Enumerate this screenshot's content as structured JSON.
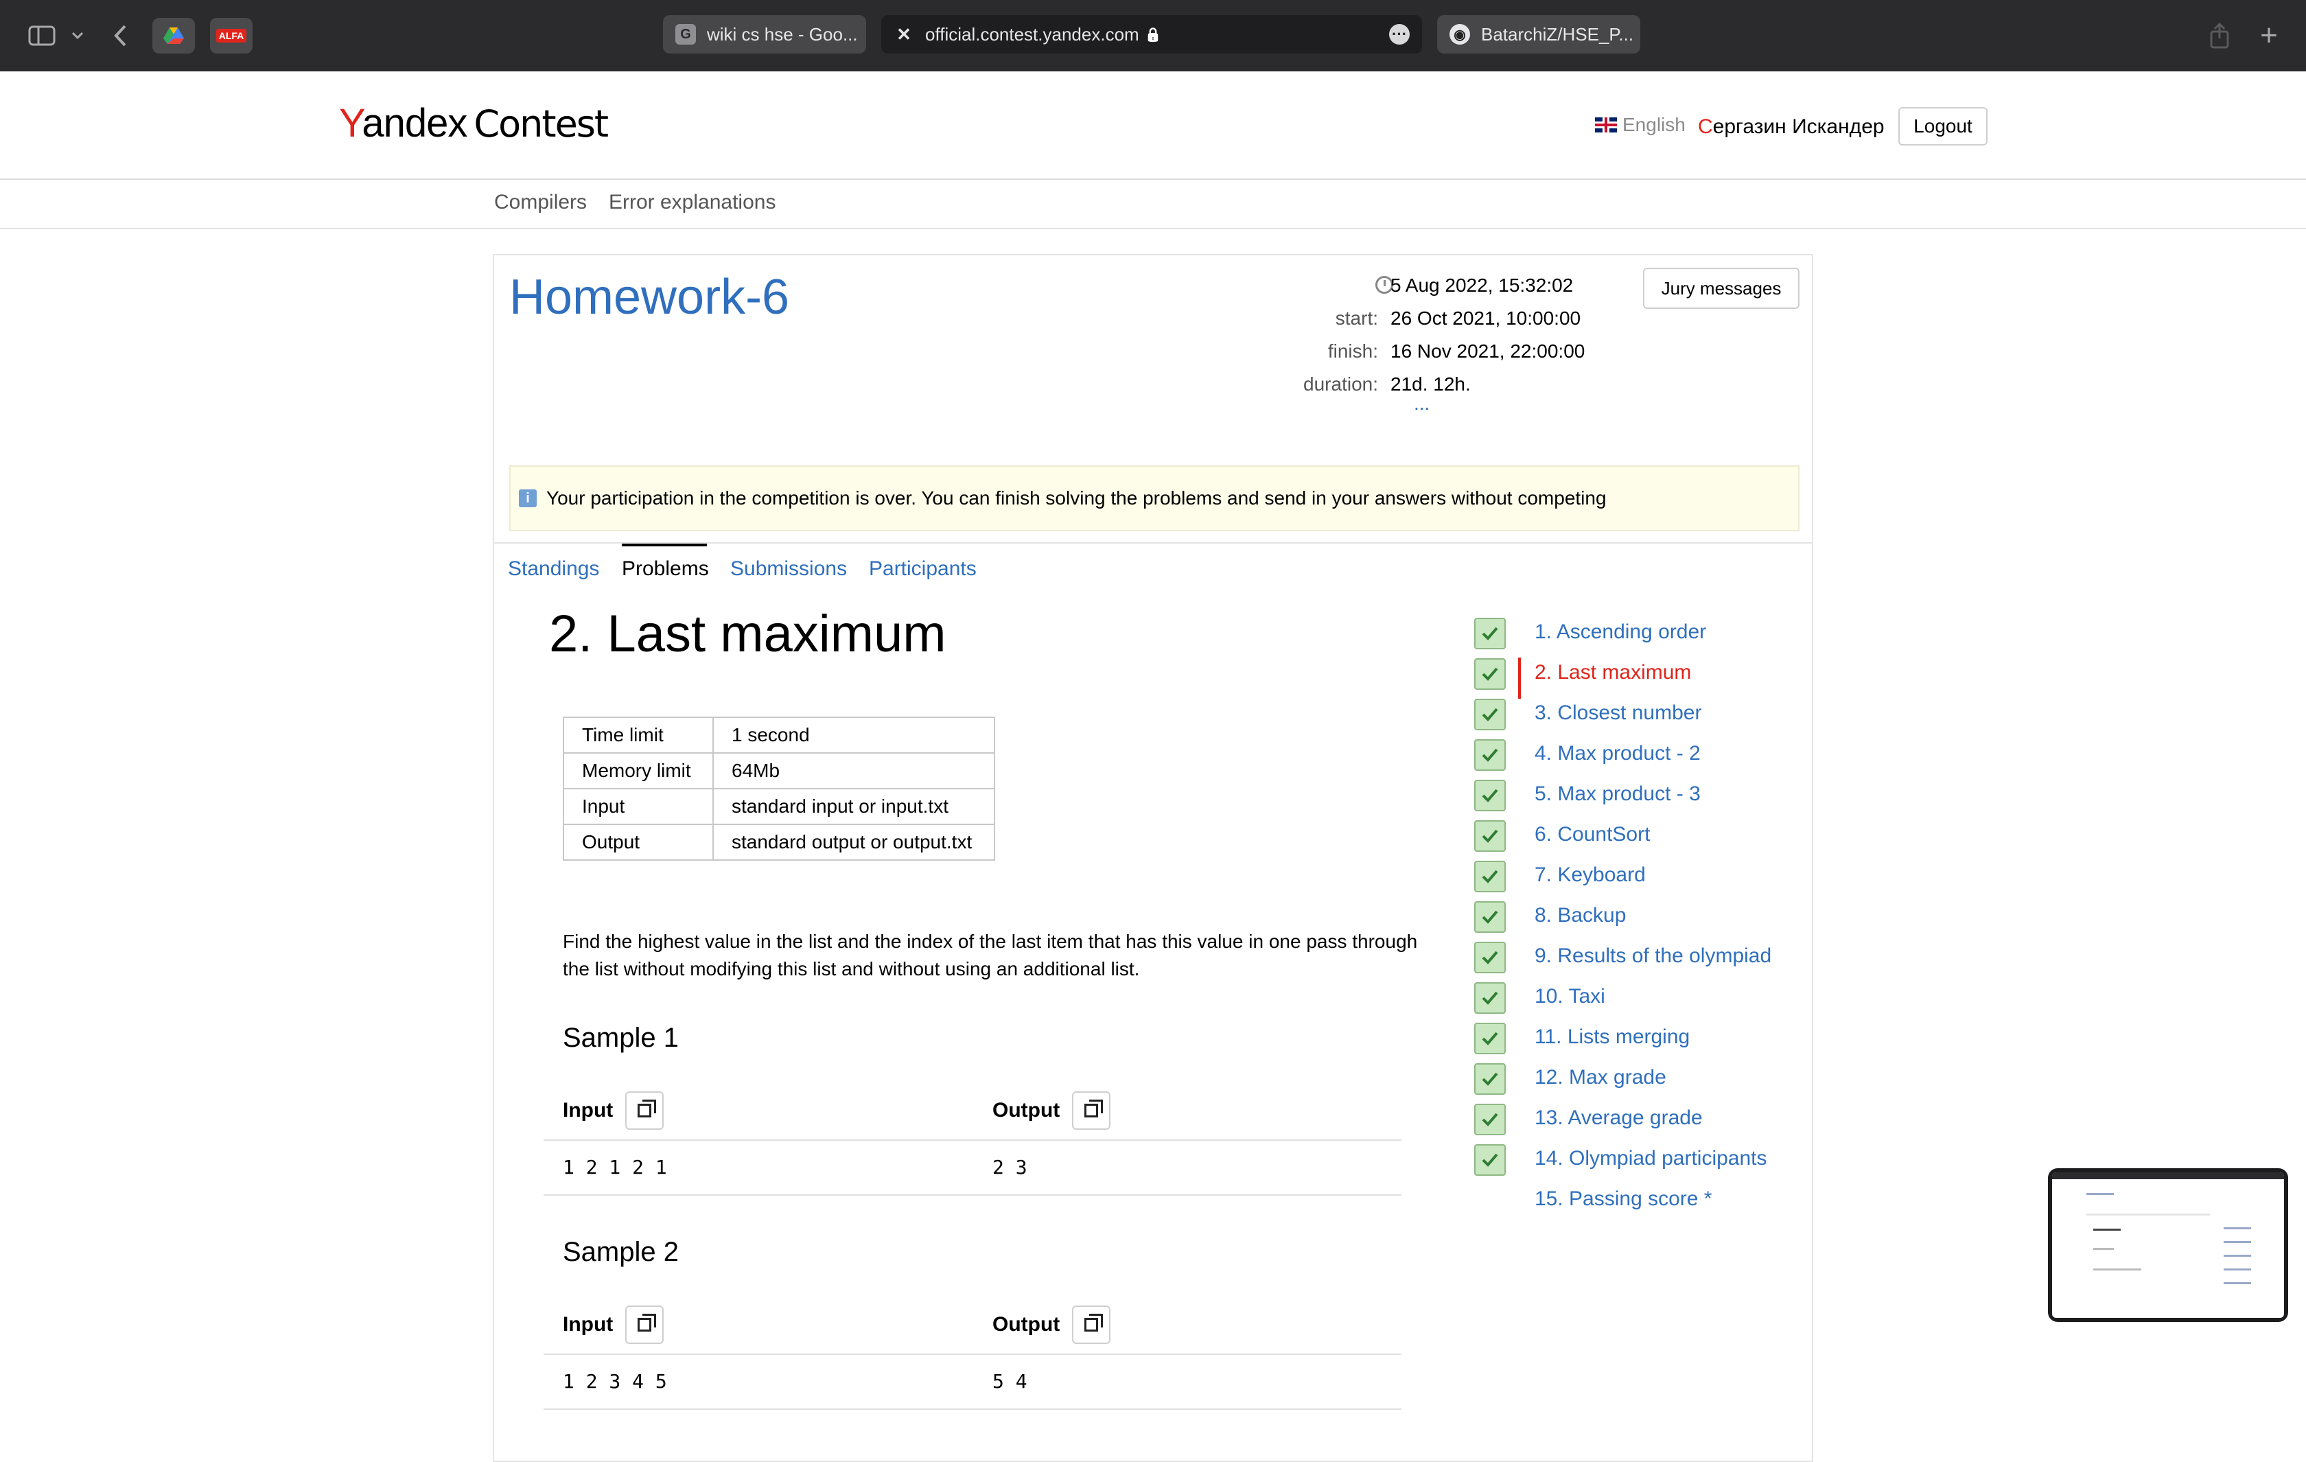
{
  "browser": {
    "tabs": [
      {
        "favicon": "G",
        "title": "wiki cs hse - Goo..."
      },
      {
        "favicon": "✕",
        "title": "official.contest.yandex.com",
        "lock": "🔒"
      },
      {
        "favicon": "◉",
        "title": "BatarchiZ/HSE_P..."
      }
    ],
    "ext1_icon": "drive-icon",
    "ext2_label": "ALFA"
  },
  "header": {
    "logo_y": "Y",
    "logo_rest": "andex",
    "logo_contest": "Contest",
    "language": "English",
    "user_first": "С",
    "user_rest": "ергазин Искандер",
    "logout": "Logout"
  },
  "subnav": {
    "compilers": "Compilers",
    "errors": "Error explanations"
  },
  "contest": {
    "title": "Homework-6",
    "now": "5 Aug 2022, 15:32:02",
    "start_label": "start:",
    "start": "26 Oct 2021, 10:00:00",
    "finish_label": "finish:",
    "finish": "16 Nov 2021, 22:00:00",
    "duration_label": "duration:",
    "duration": "21d. 12h.",
    "more": "...",
    "jury": "Jury messages",
    "notice": "Your participation in the competition is over. You can finish solving the problems and send in your answers without competing",
    "tabs": [
      "Standings",
      "Problems",
      "Submissions",
      "Participants"
    ]
  },
  "problem": {
    "title": "2. Last maximum",
    "limits": [
      {
        "label": "Time limit",
        "value": "1 second"
      },
      {
        "label": "Memory limit",
        "value": "64Mb"
      },
      {
        "label": "Input",
        "value": "standard input or input.txt"
      },
      {
        "label": "Output",
        "value": "standard output or output.txt"
      }
    ],
    "statement": "Find the highest value in the list and the index of the last item that has this value in one pass through the list without modifying this list and without using an additional list.",
    "samples": [
      {
        "title": "Sample 1",
        "input_label": "Input",
        "output_label": "Output",
        "input": "1 2 1 2 1",
        "output": "2 3"
      },
      {
        "title": "Sample 2",
        "input_label": "Input",
        "output_label": "Output",
        "input": "1 2 3 4 5",
        "output": "5 4"
      }
    ]
  },
  "problems_list": [
    {
      "label": "1. Ascending order",
      "solved": true
    },
    {
      "label": "2. Last maximum",
      "solved": true
    },
    {
      "label": "3. Closest number",
      "solved": true
    },
    {
      "label": "4. Max product - 2",
      "solved": true
    },
    {
      "label": "5. Max product - 3",
      "solved": true
    },
    {
      "label": "6. CountSort",
      "solved": true
    },
    {
      "label": "7. Keyboard",
      "solved": true
    },
    {
      "label": "8. Backup",
      "solved": true
    },
    {
      "label": "9. Results of the olympiad",
      "solved": true
    },
    {
      "label": "10. Taxi",
      "solved": true
    },
    {
      "label": "11. Lists merging",
      "solved": true
    },
    {
      "label": "12. Max grade",
      "solved": true
    },
    {
      "label": "13. Average grade",
      "solved": true
    },
    {
      "label": "14. Olympiad participants",
      "solved": true
    },
    {
      "label": "15. Passing score *",
      "solved": false
    }
  ],
  "colors": {
    "link": "#2f6fbd",
    "brand_red": "#e0241b",
    "solved_green": "#c9e7c1"
  }
}
